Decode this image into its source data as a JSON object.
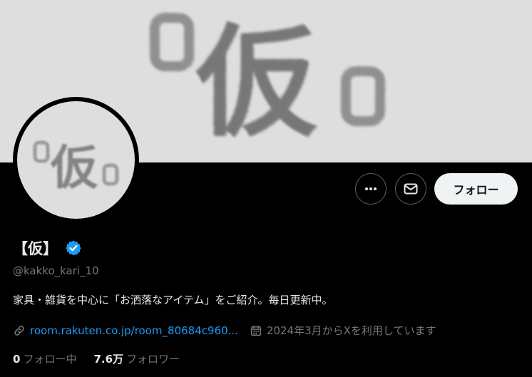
{
  "profile": {
    "banner_mark": "仮",
    "avatar_mark": "仮",
    "display_name": "【仮】",
    "handle": "@kakko_kari_10",
    "bio": "家具・雑貨を中心に「お洒落なアイテム」をご紹介。毎日更新中。",
    "link": "room.rakuten.co.jp/room_80684c960...",
    "joined": "2024年3月からXを利用しています",
    "following_count": "0",
    "following_label": "フォロー中",
    "followers_count": "7.6万",
    "followers_label": "フォロワー"
  },
  "actions": {
    "follow_label": "フォロー",
    "more_icon": "more-dots-icon",
    "message_icon": "envelope-icon"
  },
  "colors": {
    "accent": "#1d9bf0",
    "background": "#000000",
    "banner": "#dedede",
    "follow_button": "#eff3f4"
  }
}
